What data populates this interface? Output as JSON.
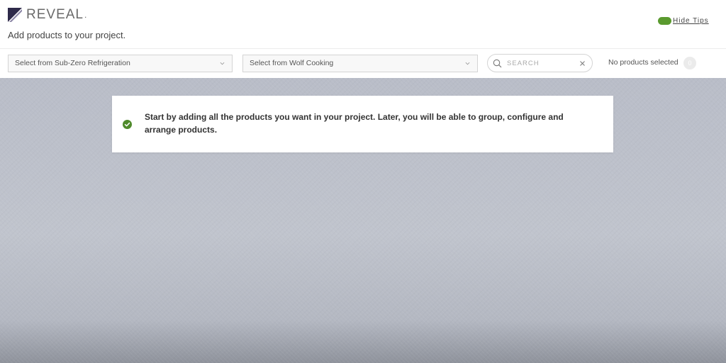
{
  "header": {
    "logo_text": "REVEAL",
    "logo_suffix": ".",
    "page_title": "Add products to your project.",
    "tips_toggle_label": "Hide Tips",
    "tips_toggle_color": "#5a9a2e"
  },
  "toolbar": {
    "select_subzero": "Select from Sub-Zero Refrigeration",
    "select_wolf": "Select from Wolf Cooking",
    "search_placeholder": "SEARCH",
    "search_value": "",
    "selected_status": "No products selected",
    "selected_count": "0"
  },
  "tip": {
    "icon": "check-circle-icon",
    "icon_color": "#4f8a2b",
    "text": "Start by adding all the products you want in your project. Later, you will be able to group, configure and arrange products."
  }
}
